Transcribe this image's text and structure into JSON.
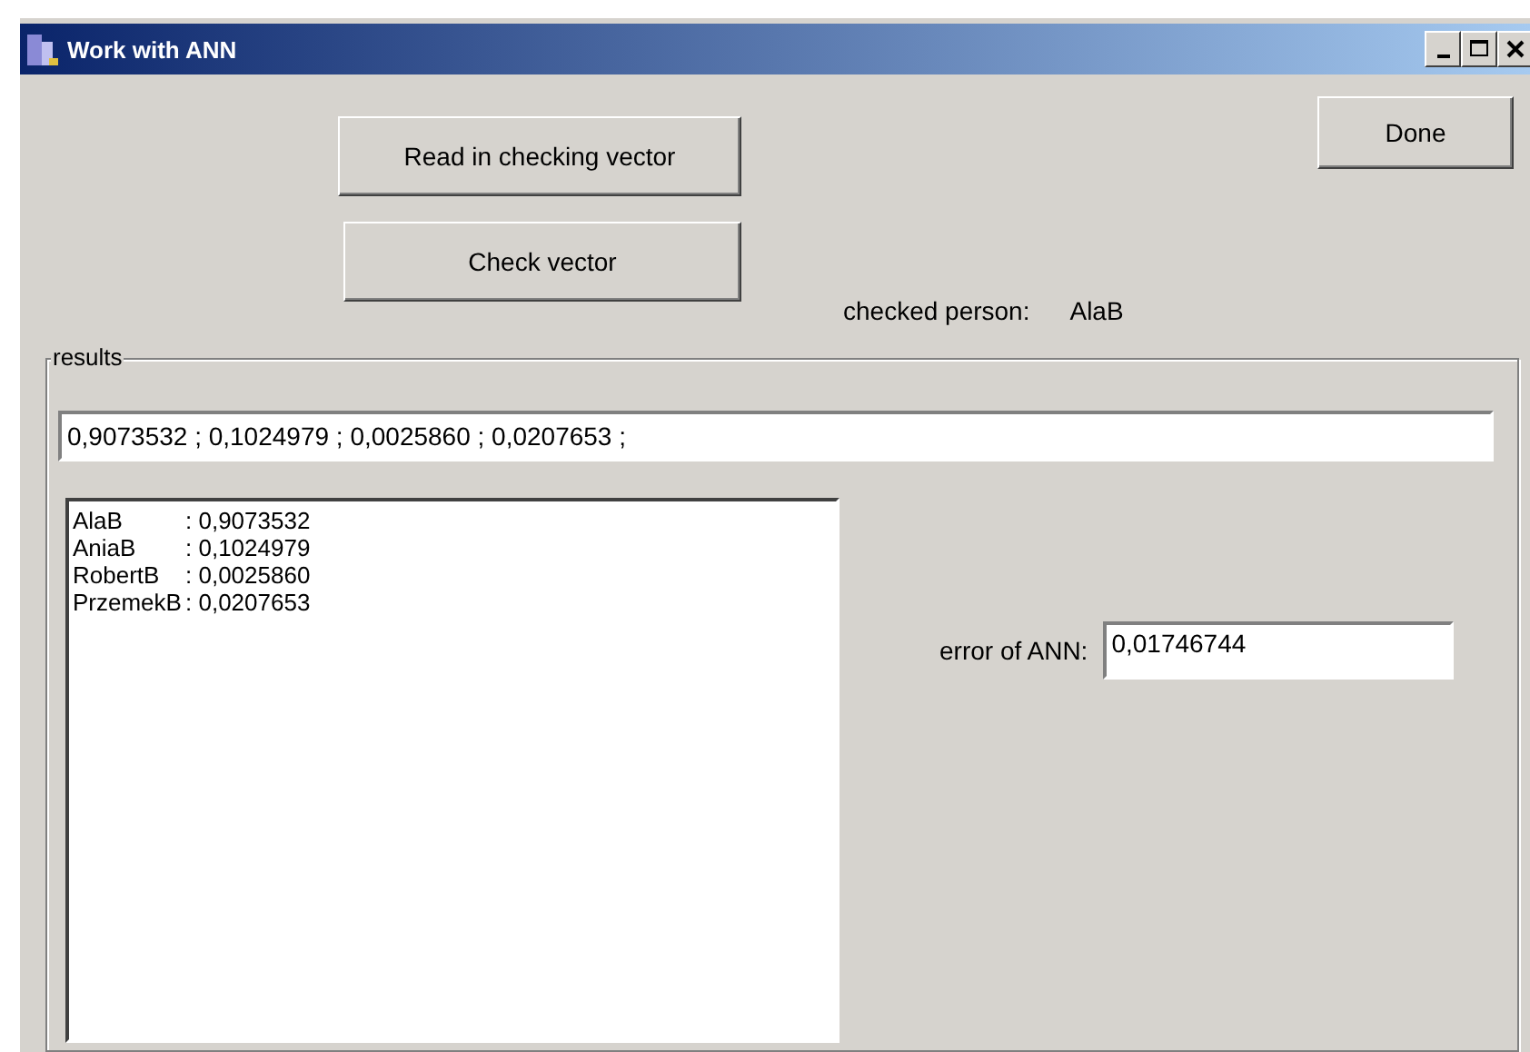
{
  "window": {
    "title": "Work with ANN"
  },
  "buttons": {
    "read": "Read in checking vector",
    "check": "Check vector",
    "done": "Done"
  },
  "checked_person": {
    "label": "checked person:",
    "value": "AlaB"
  },
  "results": {
    "legend": "results",
    "vector": "0,9073532 ; 0,1024979 ; 0,0025860 ; 0,0207653 ;",
    "list": [
      {
        "name": "AlaB",
        "value": ": 0,9073532"
      },
      {
        "name": "AniaB",
        "value": ": 0,1024979"
      },
      {
        "name": "RobertB",
        "value": ": 0,0025860"
      },
      {
        "name": "PrzemekB",
        "value": ": 0,0207653"
      }
    ],
    "error_label": "error of ANN:",
    "error_value": "0,01746744"
  }
}
